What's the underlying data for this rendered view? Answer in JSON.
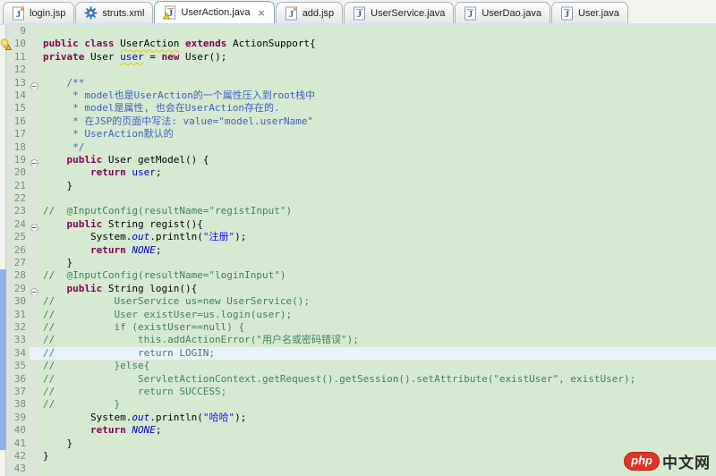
{
  "tab_close_glyph": "×",
  "tabs": [
    {
      "label": "login.jsp",
      "icon": "jsp-file-icon",
      "active": false
    },
    {
      "label": "struts.xml",
      "icon": "gear-icon",
      "active": false
    },
    {
      "label": "UserAction.java",
      "icon": "java-file-warning-icon",
      "active": true
    },
    {
      "label": "add.jsp",
      "icon": "jsp-file-icon",
      "active": false
    },
    {
      "label": "UserService.java",
      "icon": "java-file-icon",
      "active": false
    },
    {
      "label": "UserDao.java",
      "icon": "java-file-icon",
      "active": false
    },
    {
      "label": "User.java",
      "icon": "java-file-icon",
      "active": false
    }
  ],
  "editor": {
    "lines": [
      {
        "num": 9,
        "segs": []
      },
      {
        "num": 10,
        "marker": "warning-bulb",
        "segs": [
          {
            "t": "public",
            "c": "kw"
          },
          {
            "t": " ",
            "c": "pl"
          },
          {
            "t": "class",
            "c": "kw"
          },
          {
            "t": " ",
            "c": "pl"
          },
          {
            "t": "UserAction",
            "c": "warnid"
          },
          {
            "t": " ",
            "c": "pl"
          },
          {
            "t": "extends",
            "c": "kw"
          },
          {
            "t": " ActionSupport{",
            "c": "pl"
          }
        ]
      },
      {
        "num": 11,
        "segs": [
          {
            "t": "private",
            "c": "kw"
          },
          {
            "t": " User ",
            "c": "pl"
          },
          {
            "t": "user",
            "c": "fieldwarn"
          },
          {
            "t": " = ",
            "c": "pl"
          },
          {
            "t": "new",
            "c": "kw"
          },
          {
            "t": " User();",
            "c": "pl"
          }
        ]
      },
      {
        "num": 12,
        "segs": []
      },
      {
        "num": 13,
        "fold": true,
        "segs": [
          {
            "t": "    /**",
            "c": "jdoc"
          }
        ]
      },
      {
        "num": 14,
        "segs": [
          {
            "t": "     * model也是UserAction的一个属性压入到root栈中",
            "c": "jdoc"
          }
        ]
      },
      {
        "num": 15,
        "segs": [
          {
            "t": "     * model是属性, 也会在UserAction存在的.",
            "c": "jdoc"
          }
        ]
      },
      {
        "num": 16,
        "segs": [
          {
            "t": "     * 在JSP的页面中写法: value=\"model.userName\"",
            "c": "jdoc"
          }
        ]
      },
      {
        "num": 17,
        "segs": [
          {
            "t": "     * UserAction默认的",
            "c": "jdoc"
          }
        ]
      },
      {
        "num": 18,
        "segs": [
          {
            "t": "     */",
            "c": "jdoc"
          }
        ]
      },
      {
        "num": 19,
        "fold": true,
        "segs": [
          {
            "t": "    ",
            "c": "pl"
          },
          {
            "t": "public",
            "c": "kw"
          },
          {
            "t": " User getModel() {",
            "c": "pl"
          }
        ]
      },
      {
        "num": 20,
        "segs": [
          {
            "t": "        ",
            "c": "pl"
          },
          {
            "t": "return",
            "c": "kw"
          },
          {
            "t": " ",
            "c": "pl"
          },
          {
            "t": "user",
            "c": "field"
          },
          {
            "t": ";",
            "c": "pl"
          }
        ]
      },
      {
        "num": 21,
        "segs": [
          {
            "t": "    }",
            "c": "pl"
          }
        ]
      },
      {
        "num": 22,
        "segs": []
      },
      {
        "num": 23,
        "segs": [
          {
            "t": "//  @InputConfig(resultName=\"registInput\")",
            "c": "com"
          }
        ]
      },
      {
        "num": 24,
        "fold": true,
        "segs": [
          {
            "t": "    ",
            "c": "pl"
          },
          {
            "t": "public",
            "c": "kw"
          },
          {
            "t": " String regist(){",
            "c": "pl"
          }
        ]
      },
      {
        "num": 25,
        "segs": [
          {
            "t": "        System.",
            "c": "pl"
          },
          {
            "t": "out",
            "c": "sf"
          },
          {
            "t": ".println(",
            "c": "pl"
          },
          {
            "t": "\"注册\"",
            "c": "str"
          },
          {
            "t": ");",
            "c": "pl"
          }
        ]
      },
      {
        "num": 26,
        "segs": [
          {
            "t": "        ",
            "c": "pl"
          },
          {
            "t": "return",
            "c": "kw"
          },
          {
            "t": " ",
            "c": "pl"
          },
          {
            "t": "NONE",
            "c": "sf"
          },
          {
            "t": ";",
            "c": "pl"
          }
        ]
      },
      {
        "num": 27,
        "segs": [
          {
            "t": "    }",
            "c": "pl"
          }
        ]
      },
      {
        "num": 28,
        "diff": true,
        "segs": [
          {
            "t": "//  @InputConfig(resultName=\"loginInput\")",
            "c": "com"
          }
        ]
      },
      {
        "num": 29,
        "diff": true,
        "fold": true,
        "segs": [
          {
            "t": "    ",
            "c": "pl"
          },
          {
            "t": "public",
            "c": "kw"
          },
          {
            "t": " String login(){",
            "c": "pl"
          }
        ]
      },
      {
        "num": 30,
        "diff": true,
        "segs": [
          {
            "t": "//          UserService us=new UserService();",
            "c": "com"
          }
        ]
      },
      {
        "num": 31,
        "diff": true,
        "segs": [
          {
            "t": "//          User existUser=us.login(user);",
            "c": "com"
          }
        ]
      },
      {
        "num": 32,
        "diff": true,
        "segs": [
          {
            "t": "//          if (existUser==null) {",
            "c": "com"
          }
        ]
      },
      {
        "num": 33,
        "diff": true,
        "segs": [
          {
            "t": "//              this.addActionError(\"用户名或密码错误\");",
            "c": "com"
          }
        ]
      },
      {
        "num": 34,
        "diff": true,
        "highlight": true,
        "segs": [
          {
            "t": "//              return LOGIN;",
            "c": "com"
          }
        ]
      },
      {
        "num": 35,
        "diff": true,
        "segs": [
          {
            "t": "//          }else{",
            "c": "com"
          }
        ]
      },
      {
        "num": 36,
        "diff": true,
        "segs": [
          {
            "t": "//              ServletActionContext.getRequest().getSession().setAttribute(\"existUser\", existUser);",
            "c": "com"
          }
        ]
      },
      {
        "num": 37,
        "diff": true,
        "segs": [
          {
            "t": "//              return SUCCESS;",
            "c": "com"
          }
        ]
      },
      {
        "num": 38,
        "diff": true,
        "segs": [
          {
            "t": "//          }",
            "c": "com"
          }
        ]
      },
      {
        "num": 39,
        "diff": true,
        "segs": [
          {
            "t": "        System.",
            "c": "pl"
          },
          {
            "t": "out",
            "c": "sf"
          },
          {
            "t": ".println(",
            "c": "pl"
          },
          {
            "t": "\"哈哈\"",
            "c": "str"
          },
          {
            "t": ");",
            "c": "pl"
          }
        ]
      },
      {
        "num": 40,
        "diff": true,
        "segs": [
          {
            "t": "        ",
            "c": "pl"
          },
          {
            "t": "return",
            "c": "kw"
          },
          {
            "t": " ",
            "c": "pl"
          },
          {
            "t": "NONE",
            "c": "sf"
          },
          {
            "t": ";",
            "c": "pl"
          }
        ]
      },
      {
        "num": 41,
        "diff": true,
        "segs": [
          {
            "t": "    }",
            "c": "pl"
          }
        ]
      },
      {
        "num": 42,
        "segs": [
          {
            "t": "}",
            "c": "pl"
          }
        ]
      },
      {
        "num": 43,
        "segs": []
      }
    ]
  },
  "watermark": {
    "badge": "php",
    "text": "中文网"
  },
  "colors": {
    "keyword": "#7f0055",
    "string": "#2a00ff",
    "comment": "#3f7f5f",
    "javadoc": "#3f5fbf",
    "static_field": "#0000c0",
    "editor_bg": "#d6ead2",
    "current_line_bg": "#e9f1fb",
    "diff_bar": "#8db2e8",
    "warning_underline": "#e3c800",
    "watermark_red": "#e03427"
  }
}
